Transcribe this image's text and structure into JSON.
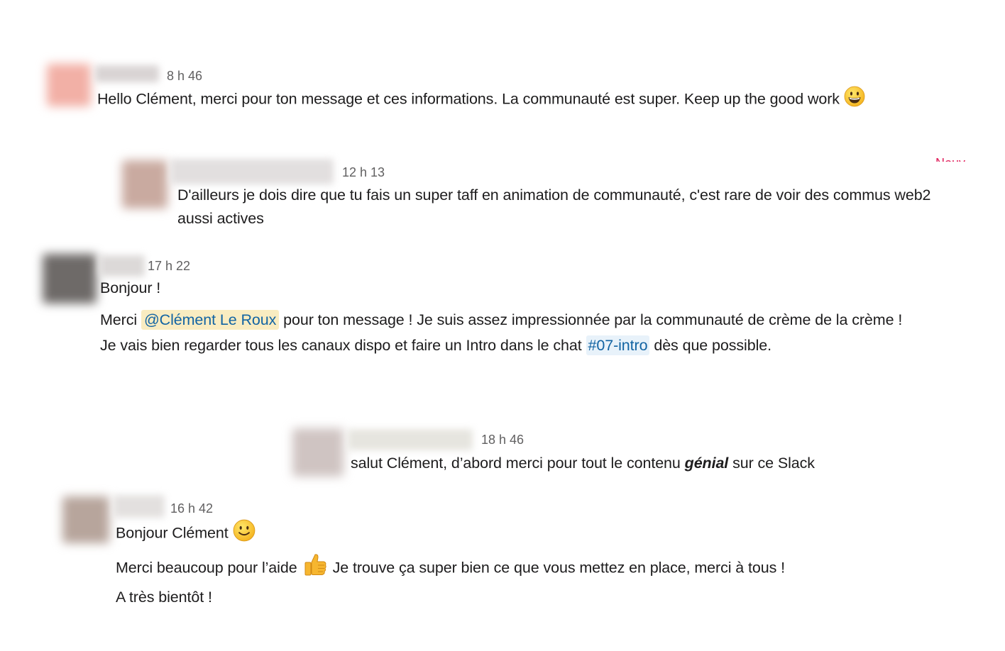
{
  "messages": [
    {
      "time": "8 h 46",
      "lines": [
        "Hello Clément, merci pour ton message et ces informations. La communauté est super. Keep up the good work"
      ],
      "emoji": "grinning-face-emoji",
      "avatar_color": "#f2b0a6"
    },
    {
      "time": "12 h 13",
      "lines": [
        "D'ailleurs je dois dire que tu fais un super taff en animation de communauté, c'est rare de voir des commus web2",
        "aussi actives"
      ],
      "avatar_color": "#c9aaa0"
    },
    {
      "time": "17 h 22",
      "greeting": "Bonjour !",
      "line1_before": "Merci",
      "mention": "@Clément Le Roux",
      "line1_after": "pour ton message ! Je suis assez impressionnée par la communauté de crème de la crème !",
      "line2_before": "Je vais bien regarder tous les canaux dispo et faire un Intro dans le chat",
      "channel": "#07-intro",
      "line2_after": "dès que possible.",
      "avatar_color": "#6e6a68"
    },
    {
      "time": "18 h 46",
      "text_before": "salut Clément, d’abord merci pour tout le contenu",
      "emphasis": "génial",
      "text_after": "sur ce Slack",
      "avatar_color": "#cfc4c2"
    },
    {
      "time": "16 h 42",
      "greeting": "Bonjour Clément",
      "greeting_emoji": "slightly-smiling-face-emoji",
      "line1_before": "Merci beaucoup pour l’aide",
      "line1_emoji": "thumbs-up-emoji",
      "line1_after": "Je trouve ça super bien ce que vous mettez en place, merci à tous !",
      "line2": "A très bientôt !",
      "avatar_color": "#b7a59c"
    }
  ],
  "colors": {
    "mention_bg": "#f9ecc1",
    "link": "#1264a3",
    "channel_bg": "#e8f2fa",
    "timestamp": "#616061"
  }
}
